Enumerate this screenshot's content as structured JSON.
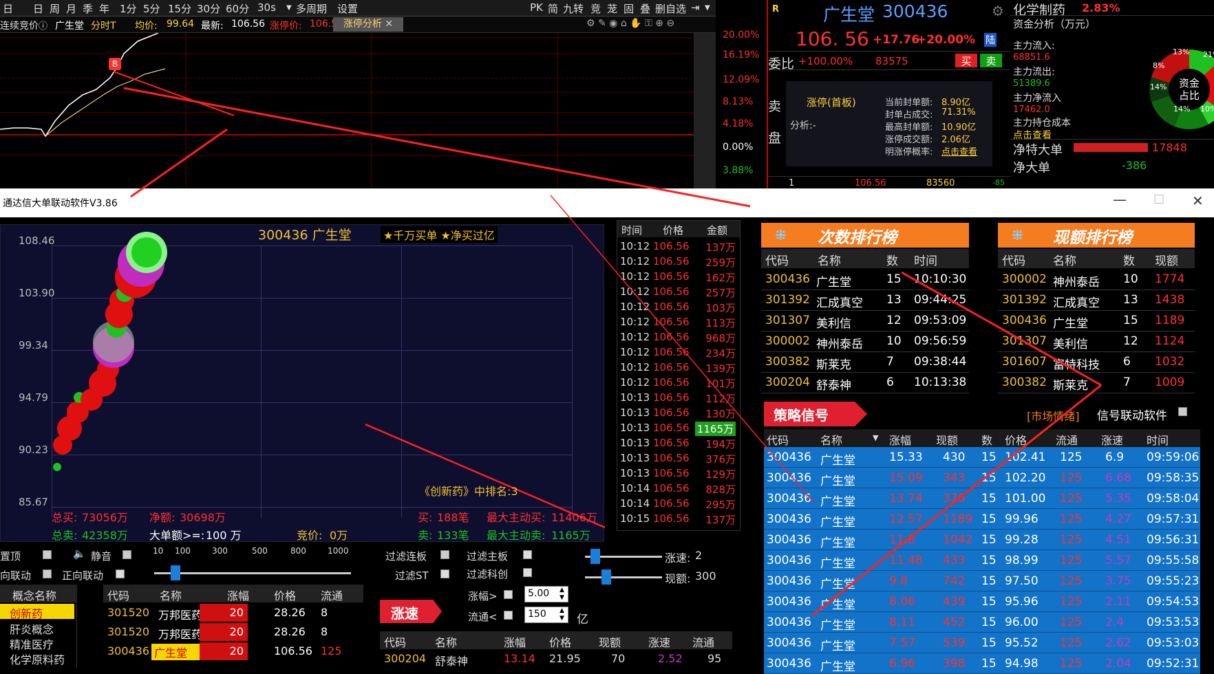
{
  "topbar": {
    "items": [
      "日",
      "周",
      "月",
      "季",
      "年",
      "1分",
      "5分",
      "15分",
      "30分",
      "60分",
      "30s",
      "多周期",
      "设置"
    ],
    "right_items": [
      "PK",
      "简",
      "九转",
      "竞",
      "茏",
      "固",
      "叠",
      "删自选"
    ],
    "lead": "日"
  },
  "infobar": {
    "prefix": "连续竞价",
    "stock": "广生堂",
    "mode": "分时T",
    "avg_label": "均价:",
    "avg": "99.64",
    "latest_label": "最新:",
    "latest": "106.56",
    "limit_label": "涨停价:",
    "limit": "106.50",
    "tab": "涨停分析"
  },
  "chart_pct_labels": [
    "20.00%",
    "16.19%",
    "12.09%",
    "8.13%",
    "4.18%",
    "0.00%",
    "3.88%"
  ],
  "marker_b": "B",
  "stock": {
    "r_badge": "R",
    "name": "广生堂",
    "code": "300436",
    "price": "106. 56",
    "change": "+17.76",
    "pct": "+20.00%",
    "tag": "陆",
    "wb_label": "委比",
    "wb": "+100.00%",
    "wb_amt": "83575",
    "buy": "买",
    "sell": "卖",
    "sell_label": "卖",
    "pan_label": "盘",
    "limit_type": "涨停(首板)",
    "analysis": "分析:-",
    "f1": "当前封单额:",
    "v1": "8.90亿",
    "f2": "封单占成交:",
    "v2": "71.31%",
    "f3": "最高封单额:",
    "v3": "10.90亿",
    "f4": "涨停成交额:",
    "v4": "2.06亿",
    "f5": "明涨停概率:",
    "v5": "点击查看",
    "bottom_row": [
      "1",
      "106.56",
      "83560",
      "-85"
    ]
  },
  "fund": {
    "sector": "化学制药",
    "sector_pct": "2.83%",
    "title": "资金分析（万元）",
    "in_label": "主力流入:",
    "in": "68851.6",
    "out_label": "主力流出:",
    "out": "51389.6",
    "net_label": "主力净流入",
    "net": "17462.0",
    "cost_label": "主力持仓成本",
    "cost": "点击查看",
    "pie_center1": "资金",
    "pie_center2": "占比",
    "pie_labels": [
      "13%",
      "21%",
      "8%",
      "14%",
      "14%",
      "10%"
    ],
    "pie_slices": [
      13,
      21,
      8,
      14,
      14,
      10,
      20
    ],
    "tedan_label": "净特大单",
    "tedan": "17848",
    "dadan_label": "净大单",
    "dadan": "-386"
  },
  "window": {
    "title": "通达信大单联动软件V3.86"
  },
  "bubble": {
    "title": "300436 广生堂",
    "tags": "★千万买单 ★净买过亿",
    "y_ticks": [
      "108.46",
      "103.90",
      "99.34",
      "94.79",
      "90.23",
      "85.67"
    ],
    "concept_rank": "《创新药》中排名:3",
    "total_buy_label": "总买:",
    "total_buy": "73056万",
    "net_label": "净额:",
    "net": "30698万",
    "total_sell_label": "总卖:",
    "total_sell": "42358万",
    "big_label": "大单额>=:",
    "big": "100 万",
    "auction_label": "竞价:",
    "auction": "0万",
    "buy_cnt_label": "买:",
    "buy_cnt": "188笔",
    "sell_cnt_label": "卖:",
    "sell_cnt": "133笔",
    "max_buy_label": "最大主动买:",
    "max_buy": "11406万",
    "max_sell_label": "最大主动卖:",
    "max_sell": "1165万"
  },
  "trades": {
    "headers": [
      "时间",
      "价格",
      "金额"
    ],
    "rows": [
      [
        "10:12",
        "106.56",
        "137万"
      ],
      [
        "10:12",
        "106.56",
        "259万"
      ],
      [
        "10:12",
        "106.56",
        "162万"
      ],
      [
        "10:12",
        "106.56",
        "257万"
      ],
      [
        "10:12",
        "106.56",
        "103万"
      ],
      [
        "10:12",
        "106.56",
        "113万"
      ],
      [
        "10:12",
        "106.56",
        "968万"
      ],
      [
        "10:12",
        "106.56",
        "234万"
      ],
      [
        "10:12",
        "106.56",
        "139万"
      ],
      [
        "10:12",
        "106.56",
        "101万"
      ],
      [
        "10:13",
        "106.56",
        "112万"
      ],
      [
        "10:13",
        "106.56",
        "130万"
      ],
      [
        "10:13",
        "106.56",
        "1165万"
      ],
      [
        "10:13",
        "106.56",
        "194万"
      ],
      [
        "10:13",
        "106.56",
        "376万"
      ],
      [
        "10:13",
        "106.56",
        "129万"
      ],
      [
        "10:14",
        "106.56",
        "828万"
      ],
      [
        "10:14",
        "106.56",
        "295万"
      ],
      [
        "10:15",
        "106.56",
        "137万"
      ]
    ]
  },
  "count_rank": {
    "title": "次数排行榜",
    "headers": [
      "代码",
      "名称",
      "数",
      "时间"
    ],
    "rows": [
      [
        "300436",
        "广生堂",
        "15",
        "10:10:30"
      ],
      [
        "301392",
        "汇成真空",
        "13",
        "09:44:25"
      ],
      [
        "301307",
        "美利信",
        "12",
        "09:53:09"
      ],
      [
        "300002",
        "神州泰岳",
        "10",
        "09:56:59"
      ],
      [
        "300382",
        "斯莱克",
        "7",
        "09:38:44"
      ],
      [
        "300204",
        "舒泰神",
        "6",
        "10:13:38"
      ]
    ]
  },
  "amount_rank": {
    "title": "现额排行榜",
    "headers": [
      "代码",
      "名称",
      "数",
      "现额"
    ],
    "rows": [
      [
        "300002",
        "神州泰岳",
        "10",
        "1774"
      ],
      [
        "301392",
        "汇成真空",
        "13",
        "1438"
      ],
      [
        "300436",
        "广生堂",
        "15",
        "1189"
      ],
      [
        "301307",
        "美利信",
        "12",
        "1124"
      ],
      [
        "301607",
        "富特科技",
        "6",
        "1032"
      ],
      [
        "300382",
        "斯莱克",
        "7",
        "1009"
      ]
    ]
  },
  "strategy": {
    "title": "策略信号",
    "market": "[市场情绪]",
    "link_label": "信号联动软件",
    "headers": [
      "代码",
      "名称",
      "涨幅",
      "现额",
      "数",
      "价格",
      "流通",
      "涨速",
      "时间"
    ],
    "rows": [
      [
        "300436",
        "广生堂",
        "15.33",
        "430",
        "15",
        "102.41",
        "125",
        "6.9",
        "09:59:06"
      ],
      [
        "300436",
        "广生堂",
        "15.09",
        "343",
        "15",
        "102.20",
        "125",
        "6.68",
        "09:58:35"
      ],
      [
        "300436",
        "广生堂",
        "13.74",
        "376",
        "15",
        "101.00",
        "125",
        "5.35",
        "09:58:04"
      ],
      [
        "300436",
        "广生堂",
        "12.57",
        "1189",
        "15",
        "99.96",
        "125",
        "4.27",
        "09:57:31"
      ],
      [
        "300436",
        "广生堂",
        "11.8",
        "1042",
        "15",
        "99.28",
        "125",
        "4.51",
        "09:56:31"
      ],
      [
        "300436",
        "广生堂",
        "11.48",
        "433",
        "15",
        "98.99",
        "125",
        "5.57",
        "09:55:58"
      ],
      [
        "300436",
        "广生堂",
        "9.8",
        "742",
        "15",
        "97.50",
        "125",
        "3.75",
        "09:55:23"
      ],
      [
        "300436",
        "广生堂",
        "8.06",
        "439",
        "15",
        "95.96",
        "125",
        "2.11",
        "09:54:53"
      ],
      [
        "300436",
        "广生堂",
        "8.11",
        "452",
        "15",
        "96.00",
        "125",
        "2.4",
        "09:53:53"
      ],
      [
        "300436",
        "广生堂",
        "7.57",
        "539",
        "15",
        "95.52",
        "125",
        "2.62",
        "09:53:03"
      ],
      [
        "300436",
        "广生堂",
        "6.96",
        "398",
        "15",
        "94.98",
        "125",
        "2.04",
        "09:52:31"
      ]
    ]
  },
  "controls": {
    "top": "置顶",
    "quiet": "静音",
    "rev": "向联动",
    "fwd": "正向联动",
    "slider_ticks": [
      "10",
      "100",
      "300",
      "500",
      "800",
      "1000"
    ],
    "f_lianban": "过滤连板",
    "f_st": "过滤ST",
    "f_zhuban": "过滤主板",
    "f_kechuang": "过滤科创",
    "zf_label": "涨幅>",
    "zf_val": "5.00",
    "lt_label": "流通<",
    "lt_val": "150",
    "yi": "亿",
    "zs_label": "涨速:",
    "zs_val": "2",
    "xe_label": "现额:",
    "xe_val": "300"
  },
  "concepts": {
    "header": "概念名称",
    "items": [
      "创新药",
      "肝炎概念",
      "精准医疗",
      "化学原料药"
    ]
  },
  "concept_stocks": {
    "headers": [
      "代码",
      "名称",
      "涨幅",
      "价格",
      "流通"
    ],
    "rows": [
      [
        "301520",
        "万邦医药",
        "20",
        "28.26",
        "8"
      ],
      [
        "301520",
        "万邦医药",
        "20",
        "28.26",
        "8"
      ],
      [
        "300436",
        "广生堂",
        "20",
        "106.56",
        "125"
      ]
    ]
  },
  "zs_table": {
    "badge": "涨速",
    "headers": [
      "代码",
      "名称",
      "涨幅",
      "价格",
      "现额",
      "涨速",
      "流通"
    ],
    "row": [
      "300204",
      "舒泰神",
      "13.14",
      "21.95",
      "70",
      "2.52",
      "95"
    ]
  },
  "colors": {
    "red": "#ff2a2a",
    "orange": "#f57c1f",
    "blue": "#1273c8",
    "gold": "#f0c030"
  }
}
